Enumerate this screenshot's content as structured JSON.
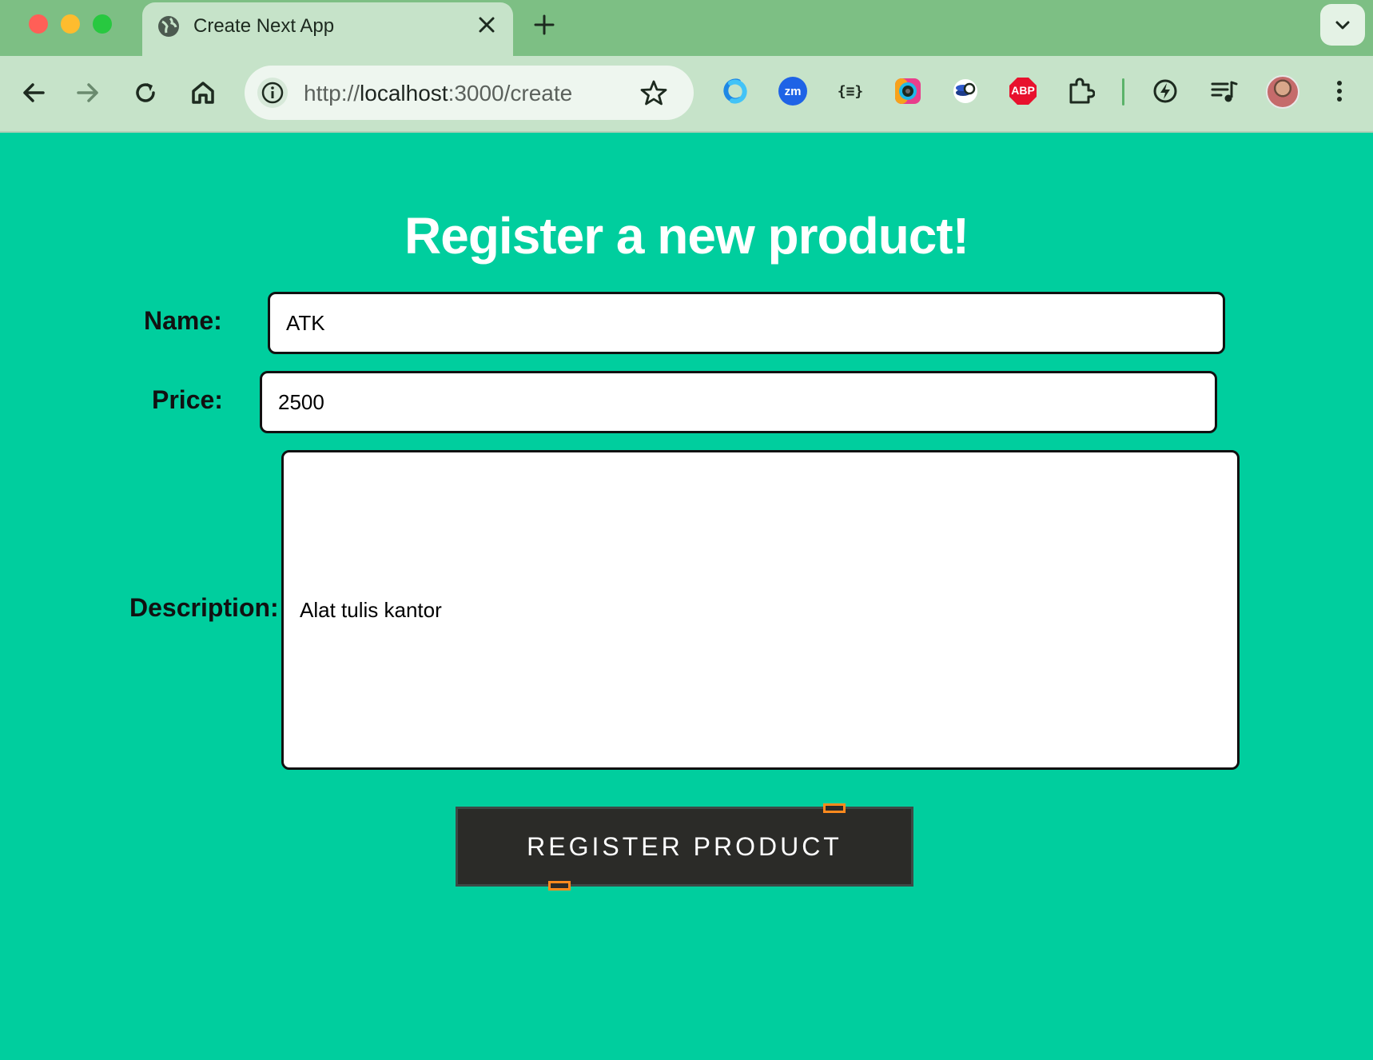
{
  "browser": {
    "tab_title": "Create Next App",
    "url_scheme": "http://",
    "url_host": "localhost",
    "url_rest": ":3000/create",
    "extensions": [
      "s-extension-icon",
      "zoom-icon",
      "json-formatter-icon",
      "screen-recorder-icon",
      "seo-icon",
      "adblock-plus-icon",
      "puzzle-icon"
    ],
    "abp_label": "ABP",
    "zm_label": "zm",
    "json_label": "{≡}"
  },
  "page": {
    "title": "Register a new product!",
    "name_label": "Name:",
    "name_value": "ATK",
    "price_label": "Price:",
    "price_value": "2500",
    "description_label": "Description:",
    "description_value": "Alat tulis kantor",
    "submit_label": "REGISTER PRODUCT"
  },
  "colors": {
    "page_bg": "#00ce9e",
    "button_bg": "#2b2b28",
    "handle": "#ff8a1e"
  }
}
